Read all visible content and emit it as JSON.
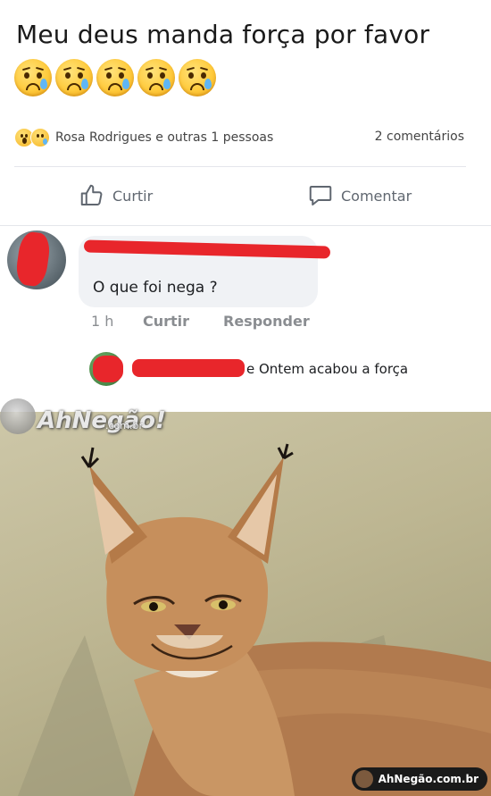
{
  "post": {
    "text": "Meu deus manda força por favor",
    "emojis": [
      "sad-tear-emoji",
      "sad-tear-emoji",
      "sad-tear-emoji",
      "sad-tear-emoji",
      "sad-tear-emoji"
    ],
    "reactions_text": "Rosa Rodrigues e outras 1 pessoas",
    "comments_count": "2 comentários",
    "like_label": "Curtir",
    "comment_label": "Comentar"
  },
  "comment": {
    "text": "O que foi nega ?",
    "time": "1 h",
    "like_label": "Curtir",
    "reply_label": "Responder"
  },
  "reply": {
    "text": "e Ontem acabou a força"
  },
  "watermark": {
    "brand": "AhNegão!",
    "sub": ".com.br",
    "badge": "AhNegão.com.br"
  },
  "colors": {
    "redaction": "#e8262b",
    "action_gray": "#606770"
  }
}
